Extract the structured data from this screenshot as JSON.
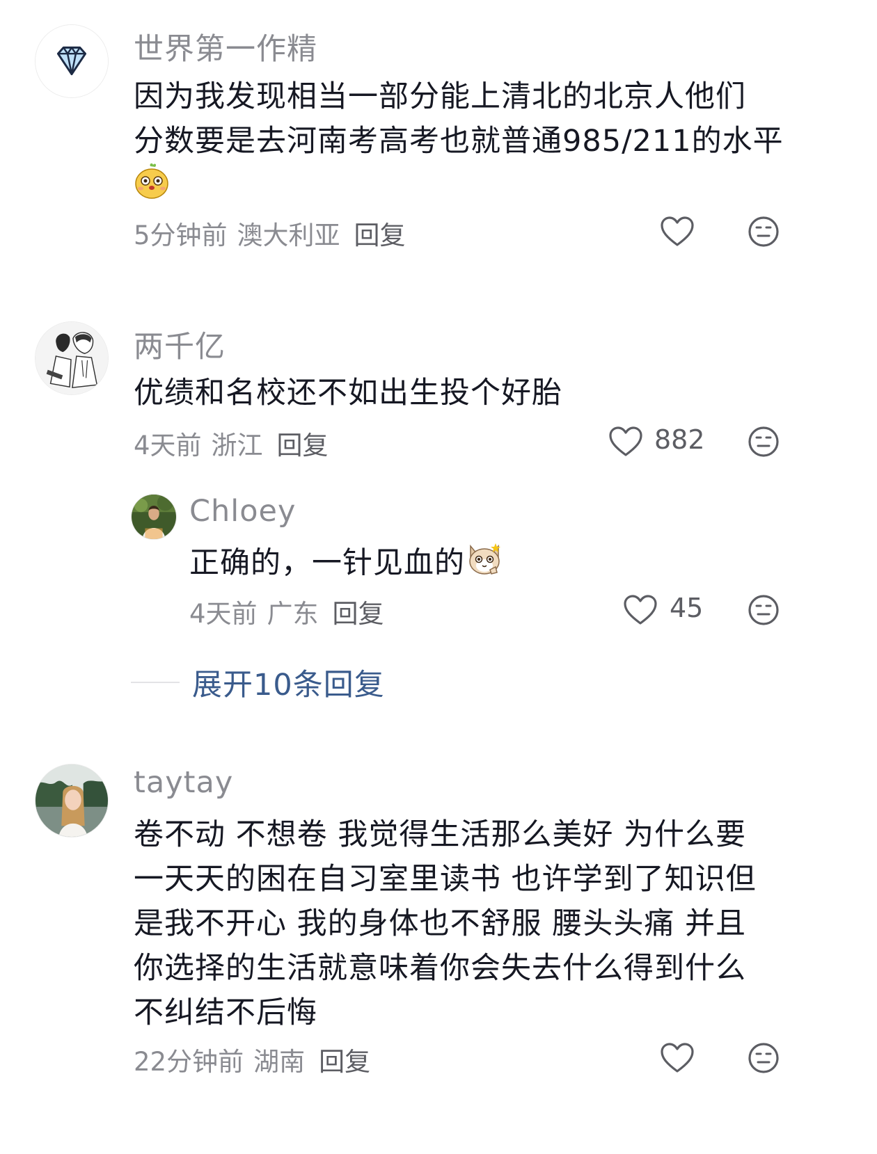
{
  "comments": [
    {
      "username": "世界第一作精",
      "avatar_icon": "diamond-icon",
      "content_lines": [
        "因为我发现相当一部分能上清北的北京人他们",
        "分数要是去河南考高考也就普通985/211的水平"
      ],
      "emoji_icon": "cute-dog-sticker-icon",
      "time": "5分钟前",
      "location": "澳大利亚",
      "reply_label": "回复",
      "like_count": ""
    },
    {
      "username": "两千亿",
      "avatar_icon": "manga-illustration-avatar",
      "content_lines": [
        "优绩和名校还不如出生投个好胎"
      ],
      "time": "4天前",
      "location": "浙江",
      "reply_label": "回复",
      "like_count": "882"
    },
    {
      "username": "Chloey",
      "avatar_icon": "photo-avatar",
      "content_text": "正确的，一针见血的",
      "emoji_icon": "cat-thumbs-up-sticker-icon",
      "time": "4天前",
      "location": "广东",
      "reply_label": "回复",
      "like_count": "45"
    },
    {
      "username": "taytay",
      "avatar_icon": "photo-avatar",
      "content_lines": [
        "卷不动 不想卷 我觉得生活那么美好 为什么要",
        "一天天的困在自习室里读书 也许学到了知识但",
        "是我不开心 我的身体也不舒服 腰头头痛  并且",
        "你选择的生活就意味着你会失去什么得到什么",
        "不纠结不后悔"
      ],
      "time": "22分钟前",
      "location": "湖南",
      "reply_label": "回复",
      "like_count": ""
    }
  ],
  "expand_replies_label": "展开10条回复",
  "colors": {
    "username": "#8a8b91",
    "text": "#161823",
    "meta": "#8a8b91",
    "link": "#3a5b8c",
    "icon": "#5c5d63"
  }
}
